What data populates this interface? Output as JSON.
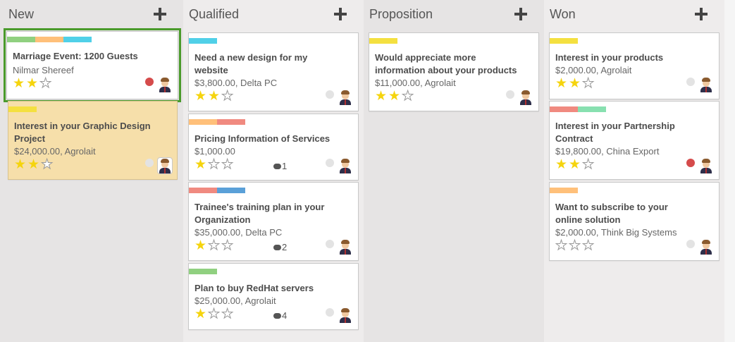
{
  "columns": [
    {
      "name": "New"
    },
    {
      "name": "Qualified"
    },
    {
      "name": "Proposition"
    },
    {
      "name": "Won"
    }
  ],
  "cards": {
    "c1": {
      "title_l1": "Marriage Event: 1200 Guests",
      "sub": "Nilmar Shereef",
      "stars": 2,
      "dot": "red",
      "tags": [
        "#90d080",
        "#ffc07a",
        "#50d0e8"
      ]
    },
    "c2": {
      "title_l1": "Interest in your Graphic Design",
      "title_l2": "Project",
      "sub": "$24,000.00, Agrolait",
      "stars": 2,
      "dot": "grey",
      "tags": [
        "#f4e040"
      ]
    },
    "q1": {
      "title_l1": "Need a new design for my",
      "title_l2": "website",
      "sub": "$3,800.00, Delta PC",
      "stars": 2,
      "dot": "grey",
      "tags": [
        "#50d0e8"
      ]
    },
    "q2": {
      "title_l1": "Pricing Information of Services",
      "sub": "$1,000.00",
      "stars": 1,
      "comments": "1",
      "dot": "grey",
      "tags": [
        "#ffc07a",
        "#f08a80"
      ]
    },
    "q3": {
      "title_l1": "Trainee's training plan in your",
      "title_l2": "Organization",
      "sub": "$35,000.00, Delta PC",
      "stars": 1,
      "comments": "2",
      "dot": "grey",
      "tags": [
        "#f08a80",
        "#5aa0d8"
      ]
    },
    "q4": {
      "title_l1": "Plan to buy RedHat servers",
      "sub": "$25,000.00, Agrolait",
      "stars": 1,
      "comments": "4",
      "dot": "grey",
      "tags": [
        "#90d080"
      ]
    },
    "p1": {
      "title_l1": "Would appreciate more",
      "title_l2": "information about your products",
      "sub": "$11,000.00, Agrolait",
      "stars": 2,
      "dot": "grey",
      "tags": [
        "#f4e040"
      ]
    },
    "w1": {
      "title_l1": "Interest in your products",
      "sub": "$2,000.00, Agrolait",
      "stars": 2,
      "dot": "grey",
      "tags": [
        "#f4e040"
      ]
    },
    "w2": {
      "title_l1": "Interest in your Partnership",
      "title_l2": "Contract",
      "sub": "$19,800.00, China Export",
      "stars": 2,
      "dot": "red",
      "tags": [
        "#f08a80",
        "#88e0b0"
      ]
    },
    "w3": {
      "title_l1": "Want to subscribe to your",
      "title_l2": "online solution",
      "sub": "$2,000.00, Think Big Systems",
      "stars": 0,
      "dot": "grey",
      "tags": [
        "#ffc07a"
      ]
    }
  }
}
